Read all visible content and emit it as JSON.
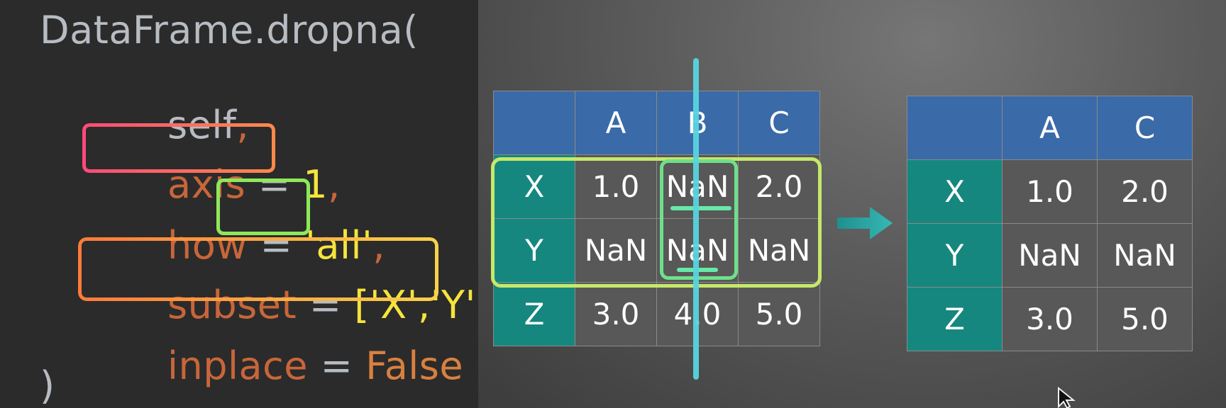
{
  "code": {
    "line1": "DataFrame.dropna(",
    "line2_kw": "self",
    "line2_comma": ",",
    "axis_kw": "axis",
    "axis_eq": " = ",
    "axis_val": "1",
    "axis_comma": ",",
    "how_kw": "how",
    "how_eq": " = ",
    "how_val": "'all'",
    "how_comma": ",",
    "subset_kw": "subset",
    "subset_eq": " = ",
    "subset_val": "['X','Y']",
    "subset_comma": ",",
    "inplace_kw": "inplace",
    "inplace_eq": " = ",
    "inplace_val": "False",
    "close": ")"
  },
  "table_before": {
    "columns": [
      "",
      "A",
      "B",
      "C"
    ],
    "rows": [
      {
        "index": "X",
        "values": [
          "1.0",
          "NaN",
          "2.0"
        ]
      },
      {
        "index": "Y",
        "values": [
          "NaN",
          "NaN",
          "NaN"
        ]
      },
      {
        "index": "Z",
        "values": [
          "3.0",
          "4.0",
          "5.0"
        ]
      }
    ]
  },
  "table_after": {
    "columns": [
      "",
      "A",
      "C"
    ],
    "rows": [
      {
        "index": "X",
        "values": [
          "1.0",
          "2.0"
        ]
      },
      {
        "index": "Y",
        "values": [
          "NaN",
          "NaN"
        ]
      },
      {
        "index": "Z",
        "values": [
          "3.0",
          "5.0"
        ]
      }
    ]
  },
  "colors": {
    "header_blue": "#3a6aa8",
    "index_teal": "#16877f",
    "cell_gray": "#585858",
    "highlight_axis": "#ff5b6e",
    "highlight_how": "#8ee85a",
    "highlight_subset": "#f7d24a",
    "drop_line": "#58d4df",
    "arrow": "#2aa8a8"
  },
  "icons": {
    "arrow": "right-arrow-icon",
    "cursor": "mouse-cursor-icon"
  }
}
